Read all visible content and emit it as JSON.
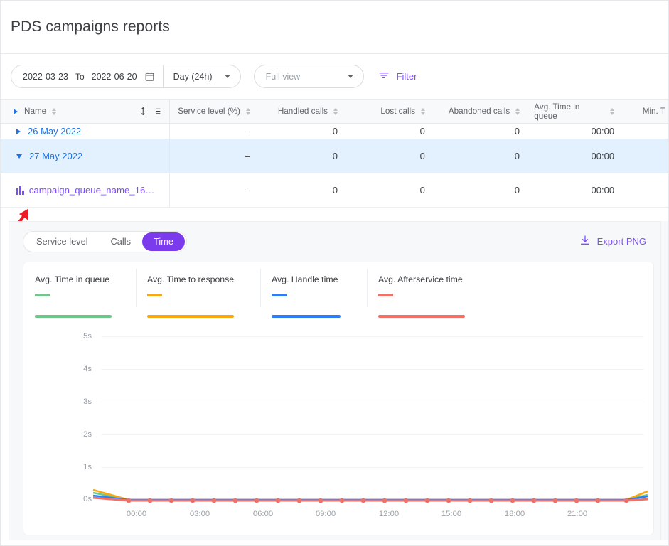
{
  "header": {
    "title": "PDS campaigns reports"
  },
  "toolbar": {
    "date_from": "2022-03-23",
    "date_to_label": "To",
    "date_to": "2022-06-20",
    "calendar_icon": "calendar-icon",
    "granularity": "Day (24h)",
    "view_placeholder": "Full view",
    "filter_label": "Filter",
    "filter_icon": "filter-icon"
  },
  "table": {
    "columns": [
      {
        "label": "Name",
        "sortable": true
      },
      {
        "label": "Service level (%)",
        "sortable": true
      },
      {
        "label": "Handled calls",
        "sortable": true
      },
      {
        "label": "Lost calls",
        "sortable": true
      },
      {
        "label": "Abandoned calls",
        "sortable": true
      },
      {
        "label": "Avg. Time in queue",
        "sortable": true
      },
      {
        "label": "Min. T",
        "sortable": false
      }
    ],
    "row_height_icon": "row-height-icon",
    "rows": [
      {
        "name": "26 May 2022",
        "expanded": false,
        "type": "group",
        "selected": false,
        "service_level": "–",
        "handled_calls": "0",
        "lost_calls": "0",
        "abandoned_calls": "0",
        "avg_time_in_queue": "00:00"
      },
      {
        "name": "27 May 2022",
        "expanded": true,
        "type": "group",
        "selected": true,
        "service_level": "–",
        "handled_calls": "0",
        "lost_calls": "0",
        "abandoned_calls": "0",
        "avg_time_in_queue": "00:00"
      },
      {
        "name": "campaign_queue_name_16…",
        "expanded": false,
        "type": "campaign",
        "selected": false,
        "service_level": "–",
        "handled_calls": "0",
        "lost_calls": "0",
        "abandoned_calls": "0",
        "avg_time_in_queue": "00:00"
      }
    ]
  },
  "chart_panel": {
    "tabs": [
      {
        "label": "Service level",
        "active": false
      },
      {
        "label": "Calls",
        "active": false
      },
      {
        "label": "Time",
        "active": true
      }
    ],
    "export_label": "Export PNG",
    "export_icon": "download-icon"
  },
  "colors": {
    "accent_purple": "#7c4dff",
    "active_purple": "#7c3aed",
    "link_blue": "#1a73e8",
    "series_green": "#6fc68a",
    "series_orange": "#f7a815",
    "series_blue": "#2f7df4",
    "series_red": "#ef7168",
    "selected_row": "#e3f0fd",
    "annotation_arrow": "#ee1c22"
  },
  "chart_data": {
    "type": "line",
    "title": "",
    "xlabel": "",
    "ylabel": "",
    "grid": true,
    "legend_position": "top",
    "ylim": [
      0,
      5.5
    ],
    "ytick_labels": [
      "0s",
      "1s",
      "2s",
      "3s",
      "4s",
      "5s"
    ],
    "ytick_values": [
      0,
      1,
      2,
      3,
      4,
      5
    ],
    "x": [
      "00:00",
      "01:00",
      "02:00",
      "03:00",
      "04:00",
      "05:00",
      "06:00",
      "07:00",
      "08:00",
      "09:00",
      "10:00",
      "11:00",
      "12:00",
      "13:00",
      "14:00",
      "15:00",
      "16:00",
      "17:00",
      "18:00",
      "19:00",
      "20:00",
      "21:00",
      "22:00",
      "23:00"
    ],
    "xtick_labels": [
      "00:00",
      "03:00",
      "06:00",
      "09:00",
      "12:00",
      "15:00",
      "18:00",
      "21:00"
    ],
    "series": [
      {
        "name": "Avg. Time in queue",
        "color": "#6fc68a",
        "values": [
          0,
          0,
          0,
          0,
          0,
          0,
          0,
          0,
          0,
          0,
          0,
          0,
          0,
          0,
          0,
          0,
          0,
          0,
          0,
          0,
          0,
          0,
          0,
          0
        ]
      },
      {
        "name": "Avg. Time to response",
        "color": "#f7a815",
        "values": [
          0,
          0,
          0,
          0,
          0,
          0,
          0,
          0,
          0,
          0,
          0,
          0,
          0,
          0,
          0,
          0,
          0,
          0,
          0,
          0,
          0,
          0,
          0,
          0
        ]
      },
      {
        "name": "Avg. Handle time",
        "color": "#2f7df4",
        "values": [
          0,
          0,
          0,
          0,
          0,
          0,
          0,
          0,
          0,
          0,
          0,
          0,
          0,
          0,
          0,
          0,
          0,
          0,
          0,
          0,
          0,
          0,
          0,
          0
        ]
      },
      {
        "name": "Avg. Afterservice time",
        "color": "#ef7168",
        "values": [
          0,
          0,
          0,
          0,
          0,
          0,
          0,
          0,
          0,
          0,
          0,
          0,
          0,
          0,
          0,
          0,
          0,
          0,
          0,
          0,
          0,
          0,
          0,
          0
        ]
      }
    ]
  }
}
